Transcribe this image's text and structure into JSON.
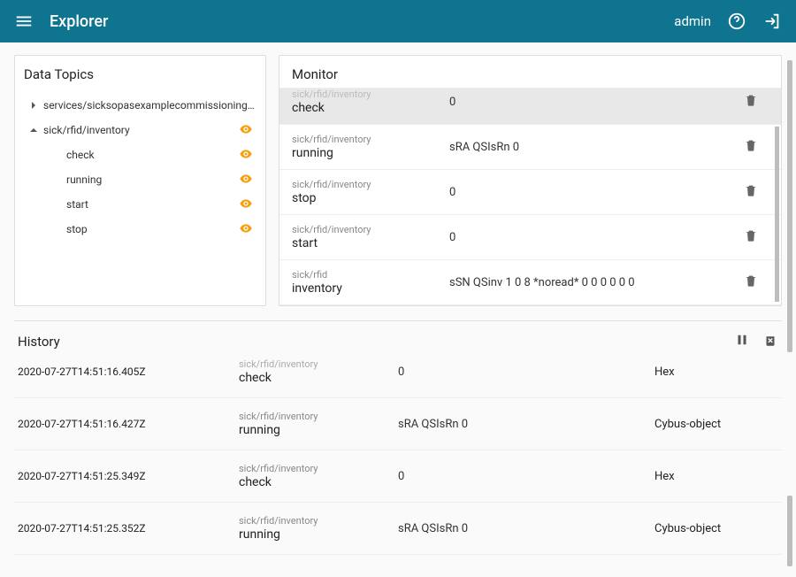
{
  "header": {
    "title": "Explorer",
    "user": "admin"
  },
  "dataTopics": {
    "title": "Data Topics",
    "items": [
      {
        "kind": "branch",
        "expanded": false,
        "label": "services/sicksopasexamplecommissioningfile",
        "eye": false
      },
      {
        "kind": "branch",
        "expanded": true,
        "label": "sick/rfid/inventory",
        "eye": true
      },
      {
        "kind": "leaf",
        "label": "check",
        "eye": true
      },
      {
        "kind": "leaf",
        "label": "running",
        "eye": true
      },
      {
        "kind": "leaf",
        "label": "start",
        "eye": true
      },
      {
        "kind": "leaf",
        "label": "stop",
        "eye": true
      }
    ]
  },
  "monitor": {
    "title": "Monitor",
    "items": [
      {
        "topic": "sick/rfid/inventory",
        "name": "check",
        "value": "0",
        "selected": true,
        "clippedTop": true
      },
      {
        "topic": "sick/rfid/inventory",
        "name": "running",
        "value": "sRA QSIsRn 0"
      },
      {
        "topic": "sick/rfid/inventory",
        "name": "stop",
        "value": "0"
      },
      {
        "topic": "sick/rfid/inventory",
        "name": "start",
        "value": "0"
      },
      {
        "topic": "sick/rfid",
        "name": "inventory",
        "value": "sSN QSinv 1 0 8 *noread* 0 0 0 0 0 0"
      }
    ]
  },
  "history": {
    "title": "History",
    "rows": [
      {
        "ts": "2020-07-27T14:51:16.405Z",
        "topic": "sick/rfid/inventory",
        "name": "check",
        "value": "0",
        "format": "Hex",
        "clippedTop": true
      },
      {
        "ts": "2020-07-27T14:51:16.427Z",
        "topic": "sick/rfid/inventory",
        "name": "running",
        "value": "sRA QSIsRn 0",
        "format": "Cybus-object"
      },
      {
        "ts": "2020-07-27T14:51:25.349Z",
        "topic": "sick/rfid/inventory",
        "name": "check",
        "value": "0",
        "format": "Hex"
      },
      {
        "ts": "2020-07-27T14:51:25.352Z",
        "topic": "sick/rfid/inventory",
        "name": "running",
        "value": "sRA QSIsRn 0",
        "format": "Cybus-object"
      }
    ]
  }
}
